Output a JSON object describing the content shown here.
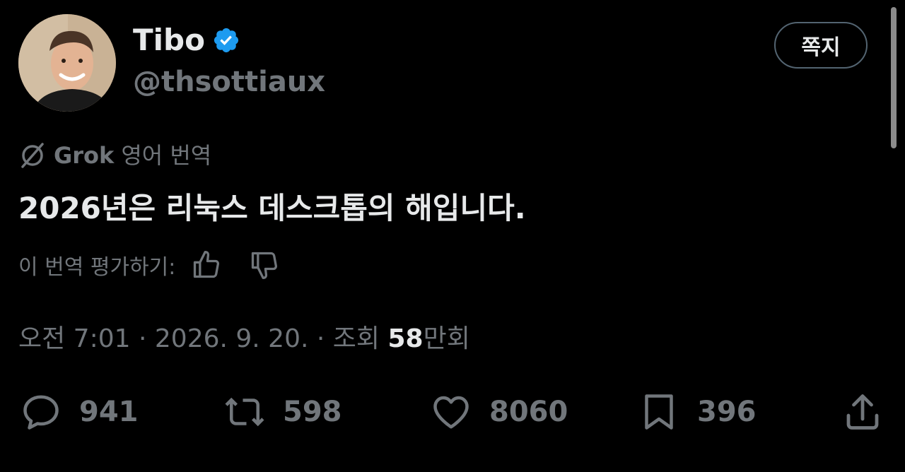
{
  "author": {
    "display_name": "Tibo",
    "handle": "@thsottiaux",
    "verified": true
  },
  "header": {
    "dm_button_label": "쪽지"
  },
  "translation": {
    "provider": "Grok",
    "label": "영어 번역",
    "text": "2026년은 리눅스 데스크톱의 해입니다.",
    "rate_label": "이 번역 평가하기:"
  },
  "meta": {
    "time": "오전 7:01",
    "separator": "·",
    "date": "2026. 9. 20.",
    "views_label": "조회",
    "views_count": "58",
    "views_unit": "만회"
  },
  "actions": {
    "replies": "941",
    "reposts": "598",
    "likes": "8060",
    "bookmarks": "396"
  },
  "icons": {
    "verified": "verified-badge-icon",
    "grok": "grok-icon",
    "thumbs_up": "thumbs-up-icon",
    "thumbs_down": "thumbs-down-icon",
    "reply": "reply-icon",
    "repost": "repost-icon",
    "like": "heart-icon",
    "bookmark": "bookmark-icon",
    "share": "share-icon"
  },
  "colors": {
    "background": "#000000",
    "primary_text": "#e7e9ea",
    "secondary_text": "#71767b",
    "verified_blue": "#1d9bf0",
    "button_border": "#536471"
  }
}
